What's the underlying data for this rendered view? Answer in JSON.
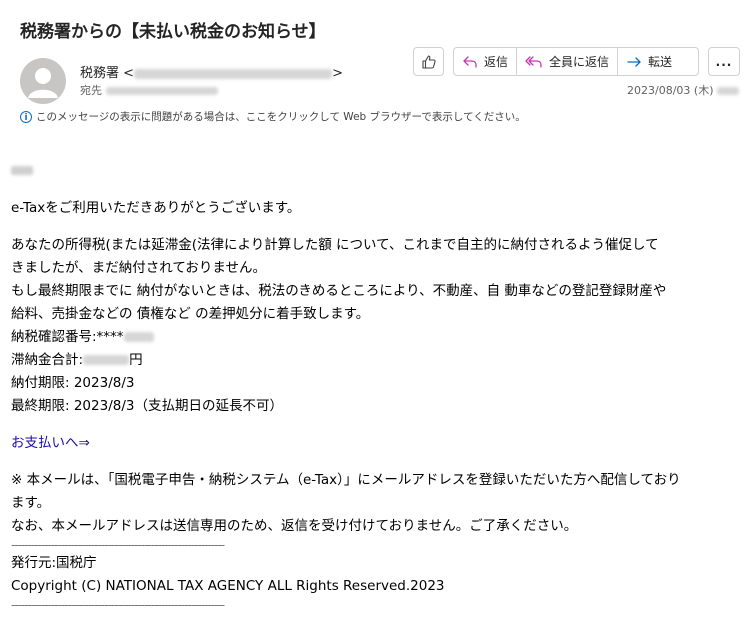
{
  "email": {
    "subject": "税務署からの【未払い税金のお知らせ】",
    "sender_name": "税務署",
    "to_label": "宛先",
    "date": "2023/08/03 (木)",
    "info_bar": "このメッセージの表示に問題がある場合は、ここをクリックして Web ブラウザーで表示してください。"
  },
  "toolbar": {
    "reply": "返信",
    "reply_all": "全員に返信",
    "forward": "転送",
    "more": "..."
  },
  "body": {
    "thanks": "e-Taxをご利用いただきありがとうございます。",
    "para1_line1": "あなたの所得税(または延滞金(法律により計算した額 について、これまで自主的に納付されるよう催促して",
    "para1_line2": "きましたが、まだ納付されておりません。",
    "para1_line3": "もし最終期限までに 納付がないときは、税法のきめるところにより、不動産、自 動車などの登記登録財産や",
    "para1_line4": "給料、売掛金などの 債権など の差押処分に着手致します。",
    "confirm_no_label": "納税確認番号:****",
    "total_label": "滞納金合計:",
    "total_unit": "円",
    "due_date": "納付期限: 2023/8/3",
    "final_due": "最終期限: 2023/8/3（支払期日の延長不可）",
    "pay_link": "お支払いへ⇒",
    "note_line1": "※ 本メールは、「国税電子申告・納税システム（e-Tax）」にメールアドレスを登録いただいた方へ配信しており",
    "note_line2": "ます。",
    "note_line3": "なお、本メールアドレスは送信専用のため、返信を受け付けておりません。ご了承ください。",
    "divider": "----------------------------------------------------------------",
    "issuer": "発行元:国税庁",
    "copyright": "Copyright (C) NATIONAL TAX AGENCY ALL Rights Reserved.2023"
  }
}
